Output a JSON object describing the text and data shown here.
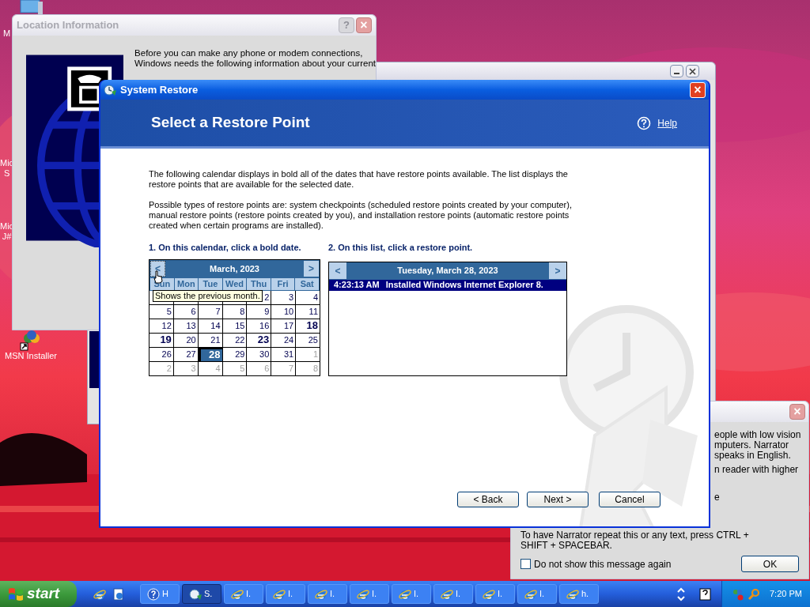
{
  "desktop_icons": [
    {
      "lines": [
        "M"
      ]
    },
    {
      "lines": [
        "Mic",
        "S"
      ]
    },
    {
      "lines": [
        "Mic",
        "J#"
      ]
    },
    {
      "lines": [
        "MSN Installer"
      ]
    }
  ],
  "location_window": {
    "title": "Location Information",
    "help": "?",
    "close": "×",
    "lines": [
      "Before you can make any phone or modem connections,",
      "Windows needs the following information about your current"
    ]
  },
  "narrator_window": {
    "close": "×",
    "fragments": [
      "eople with low vision",
      "mputers. Narrator",
      "speaks in English.",
      "n reader with higher",
      "e"
    ],
    "repeat_note": "To have Narrator repeat this or any text, press CTRL + SHIFT + SPACEBAR.",
    "checkbox": {
      "label": "Do not show this message again",
      "checked": false
    },
    "ok": "OK"
  },
  "system_restore": {
    "title": "System Restore",
    "close": "×",
    "heading": "Select a Restore Point",
    "help_link": "Help",
    "paragraphs": [
      "The following calendar displays in bold all of the dates that have restore points available. The list displays the restore points that are available for the selected date.",
      "Possible types of restore points are: system checkpoints (scheduled restore points created by your computer), manual restore points (restore points created by you), and installation restore points (automatic restore points created when certain programs are installed)."
    ],
    "step_1": "1. On this calendar, click a bold date.",
    "step_2": "2. On this list, click a restore point.",
    "calendar": {
      "month": "March, 2023",
      "prev": "<",
      "next": ">",
      "weekdays": [
        "Sun",
        "Mon",
        "Tue",
        "Wed",
        "Thu",
        "Fri",
        "Sat"
      ],
      "tooltip": "Shows the previous month.",
      "weeks": [
        [
          {
            "text": "2",
            "bold": false,
            "other_month": false,
            "selected": false
          },
          {
            "text": "3",
            "bold": false,
            "other_month": false,
            "selected": false
          },
          {
            "text": "4",
            "bold": false,
            "other_month": false,
            "selected": false
          }
        ],
        [
          {
            "text": "5",
            "bold": false,
            "other_month": false,
            "selected": false
          },
          {
            "text": "6",
            "bold": false,
            "other_month": false,
            "selected": false
          },
          {
            "text": "7",
            "bold": false,
            "other_month": false,
            "selected": false
          },
          {
            "text": "8",
            "bold": false,
            "other_month": false,
            "selected": false
          },
          {
            "text": "9",
            "bold": false,
            "other_month": false,
            "selected": false
          },
          {
            "text": "10",
            "bold": false,
            "other_month": false,
            "selected": false
          },
          {
            "text": "11",
            "bold": false,
            "other_month": false,
            "selected": false
          }
        ],
        [
          {
            "text": "12",
            "bold": false,
            "other_month": false,
            "selected": false
          },
          {
            "text": "13",
            "bold": false,
            "other_month": false,
            "selected": false
          },
          {
            "text": "14",
            "bold": false,
            "other_month": false,
            "selected": false
          },
          {
            "text": "15",
            "bold": false,
            "other_month": false,
            "selected": false
          },
          {
            "text": "16",
            "bold": false,
            "other_month": false,
            "selected": false
          },
          {
            "text": "17",
            "bold": false,
            "other_month": false,
            "selected": false
          },
          {
            "text": "18",
            "bold": true,
            "other_month": false,
            "selected": false
          }
        ],
        [
          {
            "text": "19",
            "bold": true,
            "other_month": false,
            "selected": false
          },
          {
            "text": "20",
            "bold": false,
            "other_month": false,
            "selected": false
          },
          {
            "text": "21",
            "bold": false,
            "other_month": false,
            "selected": false
          },
          {
            "text": "22",
            "bold": false,
            "other_month": false,
            "selected": false
          },
          {
            "text": "23",
            "bold": true,
            "other_month": false,
            "selected": false
          },
          {
            "text": "24",
            "bold": false,
            "other_month": false,
            "selected": false
          },
          {
            "text": "25",
            "bold": false,
            "other_month": false,
            "selected": false
          }
        ],
        [
          {
            "text": "26",
            "bold": false,
            "other_month": false,
            "selected": false
          },
          {
            "text": "27",
            "bold": false,
            "other_month": false,
            "selected": false
          },
          {
            "text": "28",
            "bold": true,
            "other_month": false,
            "selected": true
          },
          {
            "text": "29",
            "bold": false,
            "other_month": false,
            "selected": false
          },
          {
            "text": "30",
            "bold": false,
            "other_month": false,
            "selected": false
          },
          {
            "text": "31",
            "bold": false,
            "other_month": false,
            "selected": false
          },
          {
            "text": "1",
            "bold": false,
            "other_month": true,
            "selected": false
          }
        ],
        [
          {
            "text": "2",
            "bold": false,
            "other_month": true,
            "selected": false
          },
          {
            "text": "3",
            "bold": false,
            "other_month": true,
            "selected": false
          },
          {
            "text": "4",
            "bold": false,
            "other_month": true,
            "selected": false
          },
          {
            "text": "5",
            "bold": false,
            "other_month": true,
            "selected": false
          },
          {
            "text": "6",
            "bold": false,
            "other_month": true,
            "selected": false
          },
          {
            "text": "7",
            "bold": false,
            "other_month": true,
            "selected": false
          },
          {
            "text": "8",
            "bold": false,
            "other_month": true,
            "selected": false
          }
        ]
      ]
    },
    "restore_list": {
      "date": "Tuesday, March 28, 2023",
      "prev": "<",
      "next": ">",
      "items": [
        {
          "time": "4:23:13 AM",
          "description": "Installed Windows Internet Explorer 8.",
          "selected": true
        }
      ]
    },
    "buttons": [
      {
        "label": "< Back"
      },
      {
        "label": "Next >"
      },
      {
        "label": "Cancel"
      }
    ]
  },
  "taskbar": {
    "start": "start",
    "quick_launch": [
      {
        "kind": "ie"
      },
      {
        "kind": "desktop"
      }
    ],
    "tasks": [
      {
        "kind": "help",
        "label": "H",
        "selected": false
      },
      {
        "kind": "restore",
        "label": "S.",
        "selected": true
      },
      {
        "kind": "ie",
        "label": "I.",
        "selected": false
      },
      {
        "kind": "ie",
        "label": "I.",
        "selected": false
      },
      {
        "kind": "ie",
        "label": "I.",
        "selected": false
      },
      {
        "kind": "ie",
        "label": "I.",
        "selected": false
      },
      {
        "kind": "ie",
        "label": "I.",
        "selected": false
      },
      {
        "kind": "ie",
        "label": "I.",
        "selected": false
      },
      {
        "kind": "ie",
        "label": "I.",
        "selected": false
      },
      {
        "kind": "ie",
        "label": "I.",
        "selected": false
      },
      {
        "kind": "ie",
        "label": "h.",
        "selected": false
      }
    ],
    "clock": "7:20 PM"
  }
}
